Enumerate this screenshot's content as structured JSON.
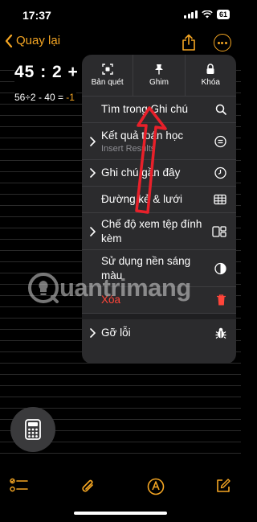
{
  "status_bar": {
    "time": "17:37",
    "battery": "61"
  },
  "nav": {
    "back_label": "Quay lại"
  },
  "note": {
    "title": "45 : 2 + 1",
    "line_expression": "56÷2 - 40 = ",
    "line_result": "-1"
  },
  "menu": {
    "quick_actions": [
      {
        "label": "Bản quét",
        "icon": "scan-icon"
      },
      {
        "label": "Ghim",
        "icon": "pin-icon"
      },
      {
        "label": "Khóa",
        "icon": "lock-icon"
      }
    ],
    "items": [
      {
        "label": "Tìm trong Ghi chú",
        "sub": "",
        "chevron": false,
        "icon": "search-icon"
      },
      {
        "label": "Kết quả toán học",
        "sub": "Insert Results",
        "chevron": true,
        "icon": "equals-circle-icon"
      },
      {
        "label": "Ghi chú gần đây",
        "sub": "",
        "chevron": true,
        "icon": "clock-icon"
      },
      {
        "label": "Đường kẻ & lưới",
        "sub": "",
        "chevron": false,
        "icon": "grid-icon"
      },
      {
        "label": "Chế độ xem tệp đính kèm",
        "sub": "",
        "chevron": true,
        "icon": "attachment-view-icon"
      },
      {
        "label": "Sử dụng nền sáng màu",
        "sub": "",
        "chevron": false,
        "icon": "contrast-icon"
      },
      {
        "label": "Xóa",
        "sub": "",
        "chevron": false,
        "icon": "trash-icon",
        "color": "#ff453a"
      },
      {
        "label": "Gỡ lỗi",
        "sub": "",
        "chevron": true,
        "icon": "bug-icon"
      }
    ]
  },
  "watermark": {
    "text": "uantrimang"
  },
  "colors": {
    "accent": "#f5a623",
    "destructive": "#ff453a",
    "arrow": "#e8202a"
  }
}
